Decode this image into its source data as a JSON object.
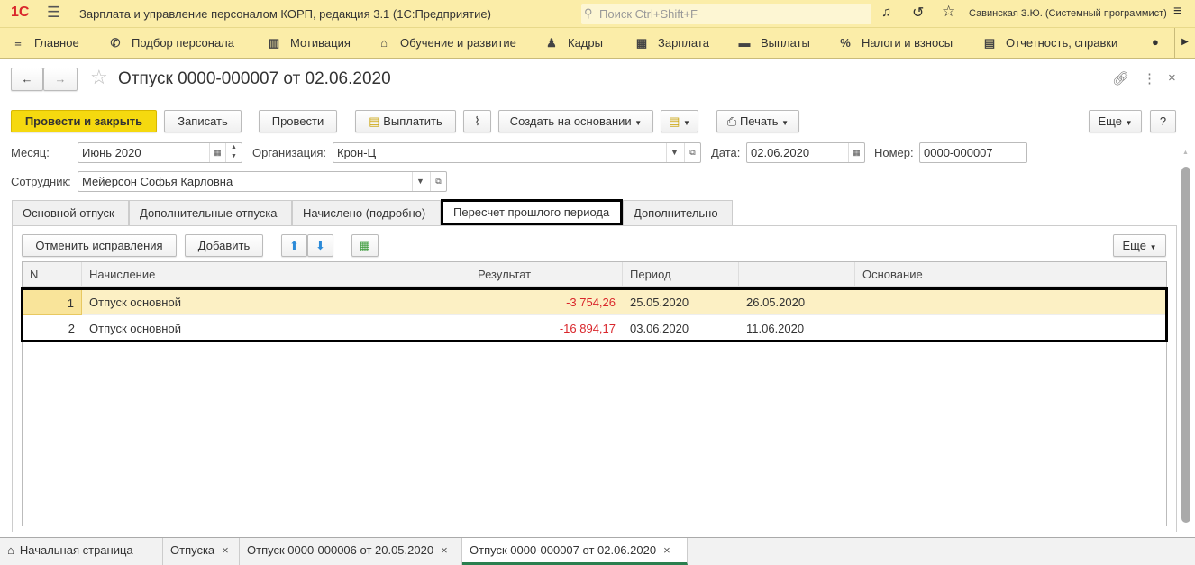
{
  "app": {
    "title": "Зарплата и управление персоналом КОРП, редакция 3.1  (1С:Предприятие)",
    "search_placeholder": "Поиск Ctrl+Shift+F",
    "user": "Савинская З.Ю. (Системный программист)",
    "logo": "1С"
  },
  "nav": [
    {
      "label": "Главное",
      "icon": "menu-icon"
    },
    {
      "label": "Подбор персонала",
      "icon": "phone-icon"
    },
    {
      "label": "Мотивация",
      "icon": "gift-icon"
    },
    {
      "label": "Обучение и развитие",
      "icon": "graduation-icon"
    },
    {
      "label": "Кадры",
      "icon": "people-icon"
    },
    {
      "label": "Зарплата",
      "icon": "calculator-icon"
    },
    {
      "label": "Выплаты",
      "icon": "wallet-icon"
    },
    {
      "label": "Налоги и взносы",
      "icon": "percent-icon"
    },
    {
      "label": "Отчетность, справки",
      "icon": "report-icon"
    }
  ],
  "document": {
    "title": "Отпуск 0000-000007 от 02.06.2020"
  },
  "toolbar": {
    "post_close": "Провести и закрыть",
    "save": "Записать",
    "post": "Провести",
    "pay": "Выплатить",
    "create_based": "Создать на основании",
    "print": "Печать",
    "more": "Еще",
    "help": "?"
  },
  "form": {
    "month_label": "Месяц:",
    "month": "Июнь 2020",
    "org_label": "Организация:",
    "org": "Крон-Ц",
    "date_label": "Дата:",
    "date": "02.06.2020",
    "number_label": "Номер:",
    "number": "0000-000007",
    "employee_label": "Сотрудник:",
    "employee": "Мейерсон Софья Карловна"
  },
  "tabs": [
    "Основной отпуск",
    "Дополнительные отпуска",
    "Начислено (подробно)",
    "Пересчет прошлого периода",
    "Дополнительно"
  ],
  "subtoolbar": {
    "cancel_fixes": "Отменить исправления",
    "add": "Добавить",
    "more": "Еще"
  },
  "table": {
    "headers": [
      "N",
      "Начисление",
      "Результат",
      "Период",
      "",
      "Основание"
    ],
    "rows": [
      {
        "n": "1",
        "accrual": "Отпуск основной",
        "result": "-3 754,26",
        "from": "25.05.2020",
        "to": "26.05.2020",
        "basis": ""
      },
      {
        "n": "2",
        "accrual": "Отпуск основной",
        "result": "-16 894,17",
        "from": "03.06.2020",
        "to": "11.06.2020",
        "basis": ""
      }
    ]
  },
  "bottom_tabs": [
    "Начальная страница",
    "Отпуска",
    "Отпуск 0000-000006 от 20.05.2020",
    "Отпуск 0000-000007 от 02.06.2020"
  ],
  "colors": {
    "accent": "#f5d90f",
    "bar": "#fbeda8",
    "negative": "#d9262b",
    "selected_row": "#fcf0c4",
    "active_tab_line": "#2a7f4f"
  }
}
